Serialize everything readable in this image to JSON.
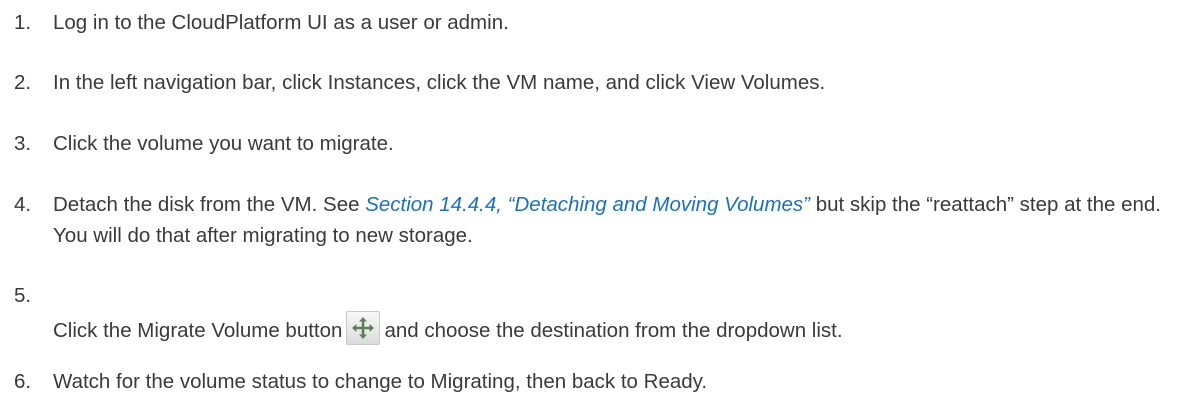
{
  "steps": [
    {
      "number": "1.",
      "text": "Log in to the CloudPlatform UI as a user or admin."
    },
    {
      "number": "2.",
      "text": "In the left navigation bar, click Instances, click the VM name, and click View Volumes."
    },
    {
      "number": "3.",
      "text": "Click the volume you want to migrate."
    },
    {
      "number": "4.",
      "text_before": "Detach the disk from the VM. See ",
      "link": "Section 14.4.4, “Detaching and Moving Volumes”",
      "text_after": " but skip the “reattach” step at the end. You will do that after migrating to new storage."
    },
    {
      "number": "5.",
      "text_before": "Click the Migrate Volume button",
      "icon": "move-arrows-icon",
      "text_after": "and choose the destination from the dropdown list."
    },
    {
      "number": "6.",
      "text": "Watch for the volume status to change to Migrating, then back to Ready."
    }
  ],
  "colors": {
    "text": "#3a3a3a",
    "link": "#1a70c4"
  }
}
